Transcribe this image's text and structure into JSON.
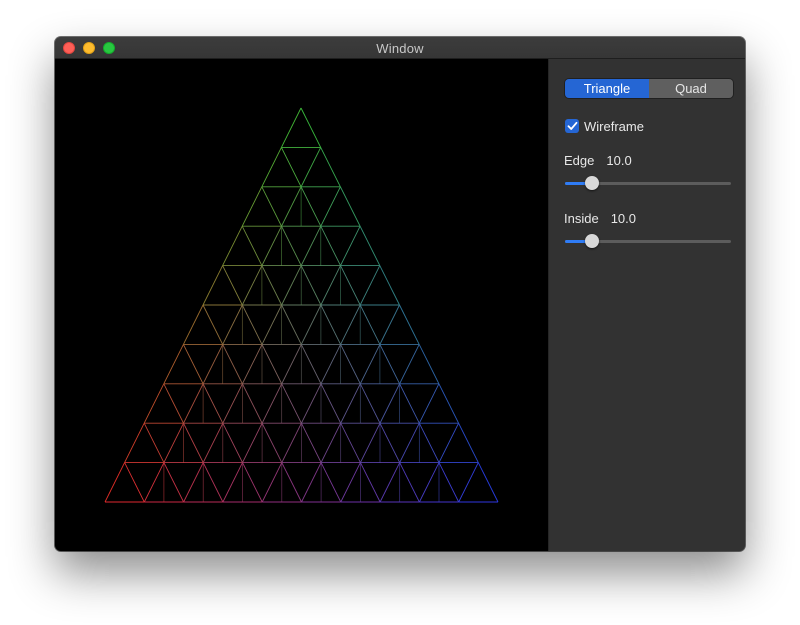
{
  "window": {
    "title": "Window"
  },
  "controls": {
    "mode": {
      "options": [
        "Triangle",
        "Quad"
      ],
      "selected": "Triangle"
    },
    "wireframe": {
      "label": "Wireframe",
      "checked": true
    },
    "edge": {
      "label": "Edge",
      "value_text": "10.0",
      "level": 0.16
    },
    "inside": {
      "label": "Inside",
      "value_text": "10.0",
      "level": 0.16
    }
  },
  "render": {
    "shape": "triangle",
    "subdivisions": 10,
    "vertex_colors": {
      "top": "#3fd23a",
      "left": "#ff2a2a",
      "right": "#2a3cff"
    },
    "background": "#000000"
  },
  "colors": {
    "accent": "#2566d4",
    "panel": "#323232"
  }
}
